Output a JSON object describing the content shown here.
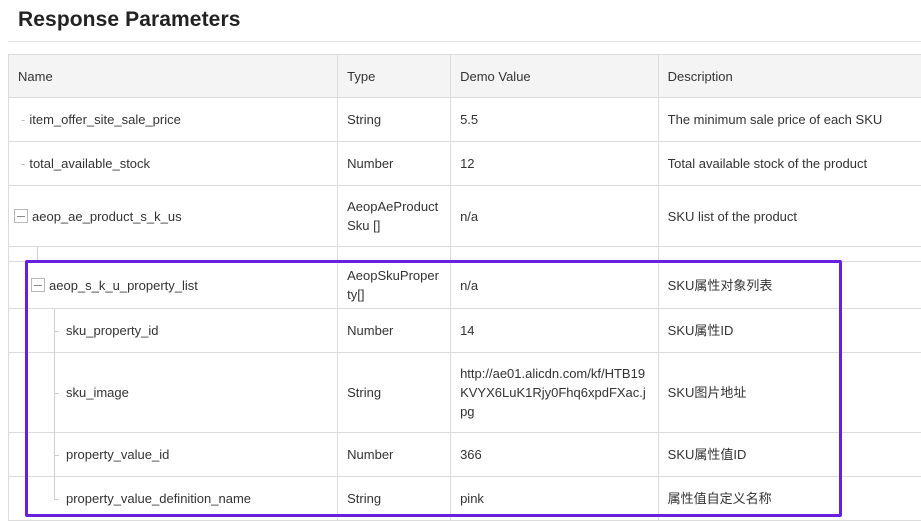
{
  "header": {
    "title": "Response Parameters"
  },
  "table": {
    "columns": [
      "Name",
      "Type",
      "Demo Value",
      "Description"
    ],
    "rows": [
      {
        "name": "item_offer_site_sale_price",
        "type": "String",
        "demo": "5.5",
        "desc": "The minimum sale price of each SKU"
      },
      {
        "name": "total_available_stock",
        "type": "Number",
        "demo": "12",
        "desc": "Total available stock of the product"
      },
      {
        "name": "aeop_ae_product_s_k_us",
        "type": "AeopAeProductSku []",
        "demo": "n/a",
        "desc": "SKU list of the product"
      },
      {
        "name": "",
        "type": "",
        "demo": "",
        "desc": ""
      },
      {
        "name": "aeop_s_k_u_property_list",
        "type": "AeopSkuProperty[]",
        "demo": "n/a",
        "desc": "SKU属性对象列表"
      },
      {
        "name": "sku_property_id",
        "type": "Number",
        "demo": "14",
        "desc": "SKU属性ID"
      },
      {
        "name": "sku_image",
        "type": "String",
        "demo": "http://ae01.alicdn.com/kf/HTB19KVYX6LuK1Rjy0Fhq6xpdFXac.jpg",
        "desc": "SKU图片地址"
      },
      {
        "name": "property_value_id",
        "type": "Number",
        "demo": "366",
        "desc": "SKU属性值ID"
      },
      {
        "name": "property_value_definition_name",
        "type": "String",
        "demo": "pink",
        "desc": "属性值自定义名称"
      }
    ]
  }
}
